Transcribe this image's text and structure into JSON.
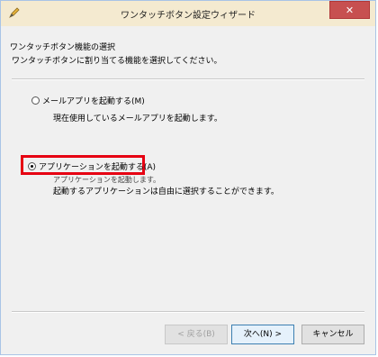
{
  "window": {
    "title": "ワンタッチボタン設定ウィザード",
    "close_label": "✕"
  },
  "section": {
    "title": "ワンタッチボタン機能の選択",
    "description": "ワンタッチボタンに割り当てる機能を選択してください。"
  },
  "options": [
    {
      "label": "メールアプリを起動する(M)",
      "description": "現在使用しているメールアプリを起動します。",
      "checked": false
    },
    {
      "label": "アプリケーションを起動する(A)",
      "description_line1": "アプリケーションを起動します。",
      "description_line2": "起動するアプリケーションは自由に選択することができます。",
      "checked": true
    }
  ],
  "buttons": {
    "back": "< 戻る(B)",
    "next": "次へ(N) >",
    "cancel": "キャンセル"
  },
  "colors": {
    "highlight": "#e60012",
    "titlebar": "#f4ead0",
    "close": "#c75050"
  },
  "icons": {
    "app": "pen-icon"
  }
}
